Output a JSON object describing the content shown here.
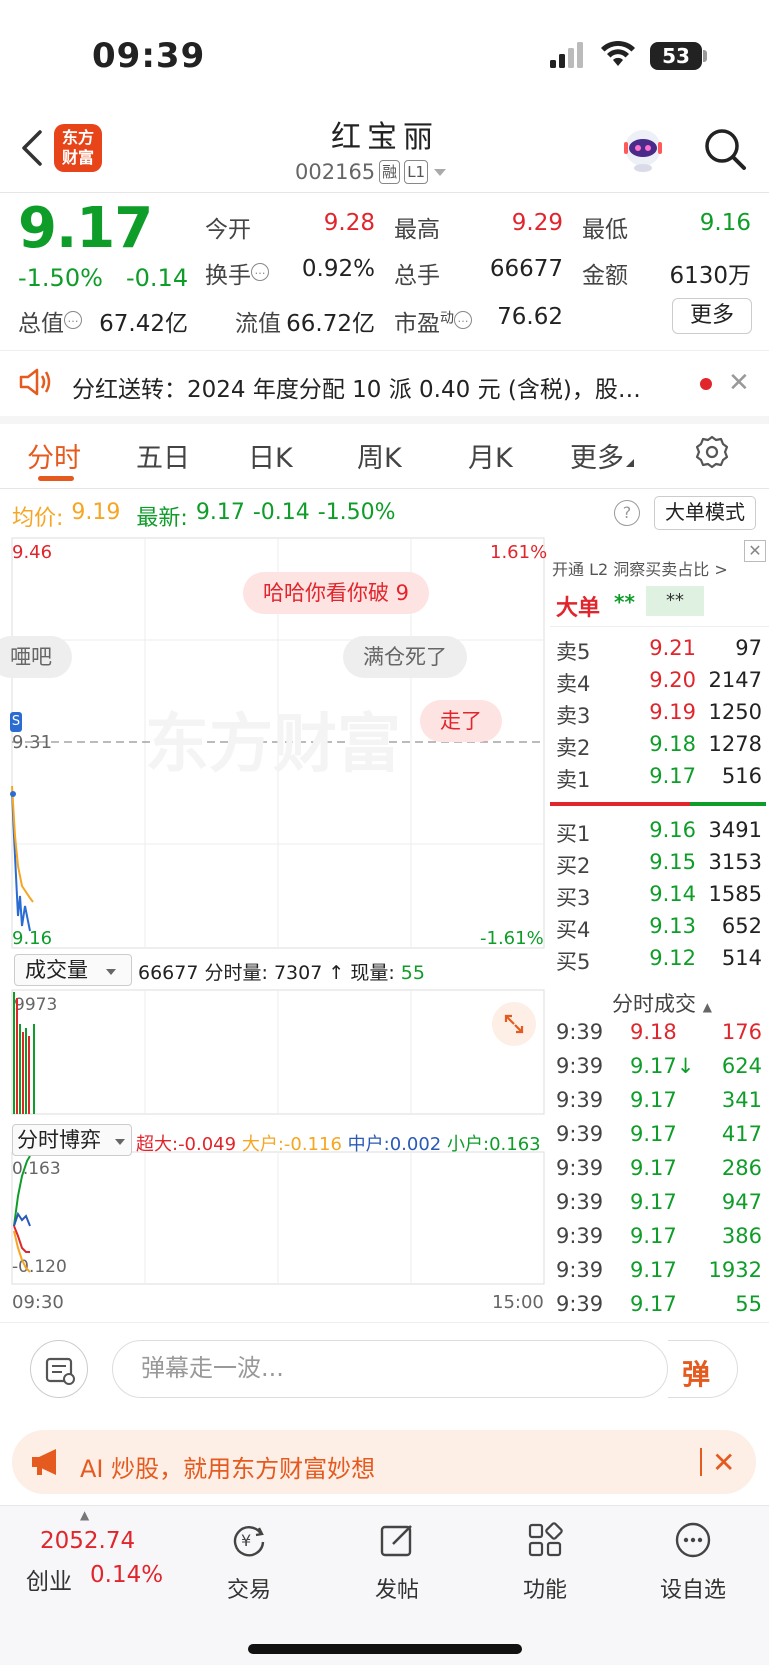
{
  "status_bar": {
    "time": "09:39",
    "battery": "53"
  },
  "header": {
    "app_logo_line1": "东方",
    "app_logo_line2": "财富",
    "stock_name": "红宝丽",
    "stock_code": "002165",
    "tag_rong": "融",
    "tag_level": "L1"
  },
  "quote": {
    "price": "9.17",
    "change_pct": "-1.50%",
    "change": "-0.14",
    "open_label": "今开",
    "open": "9.28",
    "high_label": "最高",
    "high": "9.29",
    "low_label": "最低",
    "low": "9.16",
    "turnover_label": "换手",
    "turnover": "0.92%",
    "volume_label": "总手",
    "volume": "66677",
    "amount_label": "金额",
    "amount": "6130万",
    "mktcap_label": "总值",
    "mktcap": "67.42亿",
    "float_label": "流值",
    "float": "66.72亿",
    "pe_label": "市盈",
    "pe_sup": "动",
    "pe": "76.62",
    "more_label": "更多"
  },
  "notice": {
    "text": "分红送转：2024 年度分配 10 派 0.40 元 (含税)，股…"
  },
  "tabs": [
    "分时",
    "五日",
    "日K",
    "周K",
    "月K",
    "更多"
  ],
  "avg_row": {
    "avg_label": "均价:",
    "avg": "9.19",
    "latest_label": "最新:",
    "latest": "9.17",
    "chg": "-0.14",
    "pct": "-1.50%",
    "bigorder_label": "大单模式"
  },
  "chart": {
    "y_top": "9.46",
    "y_top_pct": "1.61%",
    "y_mid": "9.31",
    "y_bottom": "9.16",
    "y_bottom_pct": "-1.61%",
    "watermark": "东方财富",
    "bullets": [
      "哈哈你看你破 9",
      "满仓死了",
      "走了",
      "唖吧"
    ],
    "volume_selector": "成交量",
    "volume_info_total": "66677",
    "volume_info_label1": "分时量:",
    "volume_info_val1": "7307 ↑",
    "volume_info_label2": "现量:",
    "volume_info_val2": "55",
    "volume_max": "9973",
    "game_selector": "分时博弈",
    "game_super": "超大:-0.049",
    "game_big": "大户:-0.116",
    "game_mid": "中户:0.002",
    "game_small": "小户:0.163",
    "game_top": "0.163",
    "game_bottom": "-0.120",
    "time_start": "09:30",
    "time_end": "15:00"
  },
  "orderbook": {
    "l2_header": "开通 L2 洞察买卖占比 >",
    "bigorder_label": "大单",
    "bigorder_val1": "**",
    "bigorder_val2": "**",
    "asks": [
      {
        "label": "卖5",
        "price": "9.21",
        "vol": "97"
      },
      {
        "label": "卖4",
        "price": "9.20",
        "vol": "2147"
      },
      {
        "label": "卖3",
        "price": "9.19",
        "vol": "1250"
      },
      {
        "label": "卖2",
        "price": "9.18",
        "vol": "1278"
      },
      {
        "label": "卖1",
        "price": "9.17",
        "vol": "516"
      }
    ],
    "bids": [
      {
        "label": "买1",
        "price": "9.16",
        "vol": "3491"
      },
      {
        "label": "买2",
        "price": "9.15",
        "vol": "3153"
      },
      {
        "label": "买3",
        "price": "9.14",
        "vol": "1585"
      },
      {
        "label": "买4",
        "price": "9.13",
        "vol": "652"
      },
      {
        "label": "买5",
        "price": "9.12",
        "vol": "514"
      }
    ],
    "ticks_header": "分时成交",
    "ticks": [
      {
        "time": "9:39",
        "price": "9.18",
        "vol": "176",
        "color": "red"
      },
      {
        "time": "9:39",
        "price": "9.17↓",
        "vol": "624",
        "color": "green"
      },
      {
        "time": "9:39",
        "price": "9.17",
        "vol": "341",
        "color": "green"
      },
      {
        "time": "9:39",
        "price": "9.17",
        "vol": "417",
        "color": "green"
      },
      {
        "time": "9:39",
        "price": "9.17",
        "vol": "286",
        "color": "green"
      },
      {
        "time": "9:39",
        "price": "9.17",
        "vol": "947",
        "color": "green"
      },
      {
        "time": "9:39",
        "price": "9.17",
        "vol": "386",
        "color": "green"
      },
      {
        "time": "9:39",
        "price": "9.17",
        "vol": "1932",
        "color": "green"
      },
      {
        "time": "9:39",
        "price": "9.17",
        "vol": "55",
        "color": "green"
      }
    ]
  },
  "danmu": {
    "placeholder": "弹幕走一波...",
    "send_label": "弹"
  },
  "ai_banner": {
    "text": "AI 炒股，就用东方财富妙想"
  },
  "tabbar": {
    "index_value": "2052.74",
    "index_name": "创业",
    "index_pct": "0.14%",
    "items": [
      "交易",
      "发帖",
      "功能",
      "设自选"
    ]
  },
  "colors": {
    "up": "#e0262c",
    "down": "#0f9d2a",
    "accent": "#e55a1e"
  }
}
